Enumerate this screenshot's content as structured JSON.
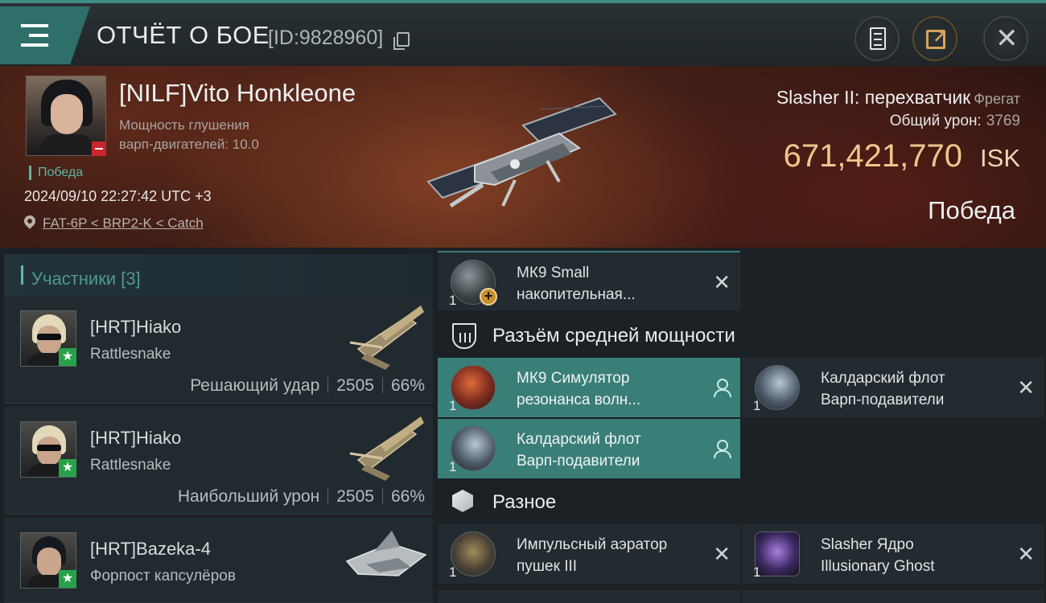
{
  "header": {
    "title": "ОТЧЁТ О БОЕ",
    "battle_id": "[ID:9828960]"
  },
  "victim": {
    "name": "[NILF]Vito Honkleone",
    "attribute_line1": "Мощность глушения",
    "attribute_line2": "варп-двигателей: 10.0",
    "tag": "Победа",
    "timestamp": "2024/09/10 22:27:42 UTC +3",
    "location": "FAT-6P < BRP2-K < Catch"
  },
  "summary": {
    "ship_name": "Slasher II: перехватчик",
    "ship_class": "Фрегат",
    "damage_label": "Общий урон:",
    "damage_value": "3769",
    "isk_value": "671,421,770",
    "isk_currency": "ISK",
    "result": "Победа"
  },
  "participants": {
    "header": "Участники [3]",
    "rows": [
      {
        "name": "[HRT]Hiako",
        "ship": "Rattlesnake",
        "role": "Решающий удар",
        "damage": "2505",
        "percent": "66%"
      },
      {
        "name": "[HRT]Hiako",
        "ship": "Rattlesnake",
        "role": "Наибольший урон",
        "damage": "2505",
        "percent": "66%"
      },
      {
        "name": "[HRT]Bazeka-4",
        "ship": "Форпост капсулёров"
      }
    ]
  },
  "modules": {
    "top_item": {
      "qty": "1",
      "line1": "МК9 Small",
      "line2": "накопительная..."
    },
    "mid_section_title": "Разъём средней мощности",
    "mid_items": [
      {
        "qty": "1",
        "line1": "МК9 Симулятор",
        "line2": "резонанса волн..."
      },
      {
        "qty": "1",
        "line1": "Калдарский флот",
        "line2": "Варп-подавители"
      },
      {
        "qty": "1",
        "line1": "Калдарский флот",
        "line2": "Варп-подавители"
      }
    ],
    "misc_section_title": "Разное",
    "misc_items": [
      {
        "qty": "1",
        "line1": "Импульсный аэратор",
        "line2": "пушек III"
      },
      {
        "qty": "1",
        "line1": "Slasher Ядро",
        "line2": "Illusionary Ghost"
      }
    ]
  },
  "colors": {
    "accent": "#3a7f77",
    "isk": "#efc78e",
    "victory_green": "#58b7a8"
  },
  "icons": [
    "menu-icon",
    "copy-icon",
    "clipboard-icon",
    "share-icon",
    "close-icon",
    "location-pin-icon",
    "shield-icon",
    "cube-icon",
    "person-icon"
  ]
}
